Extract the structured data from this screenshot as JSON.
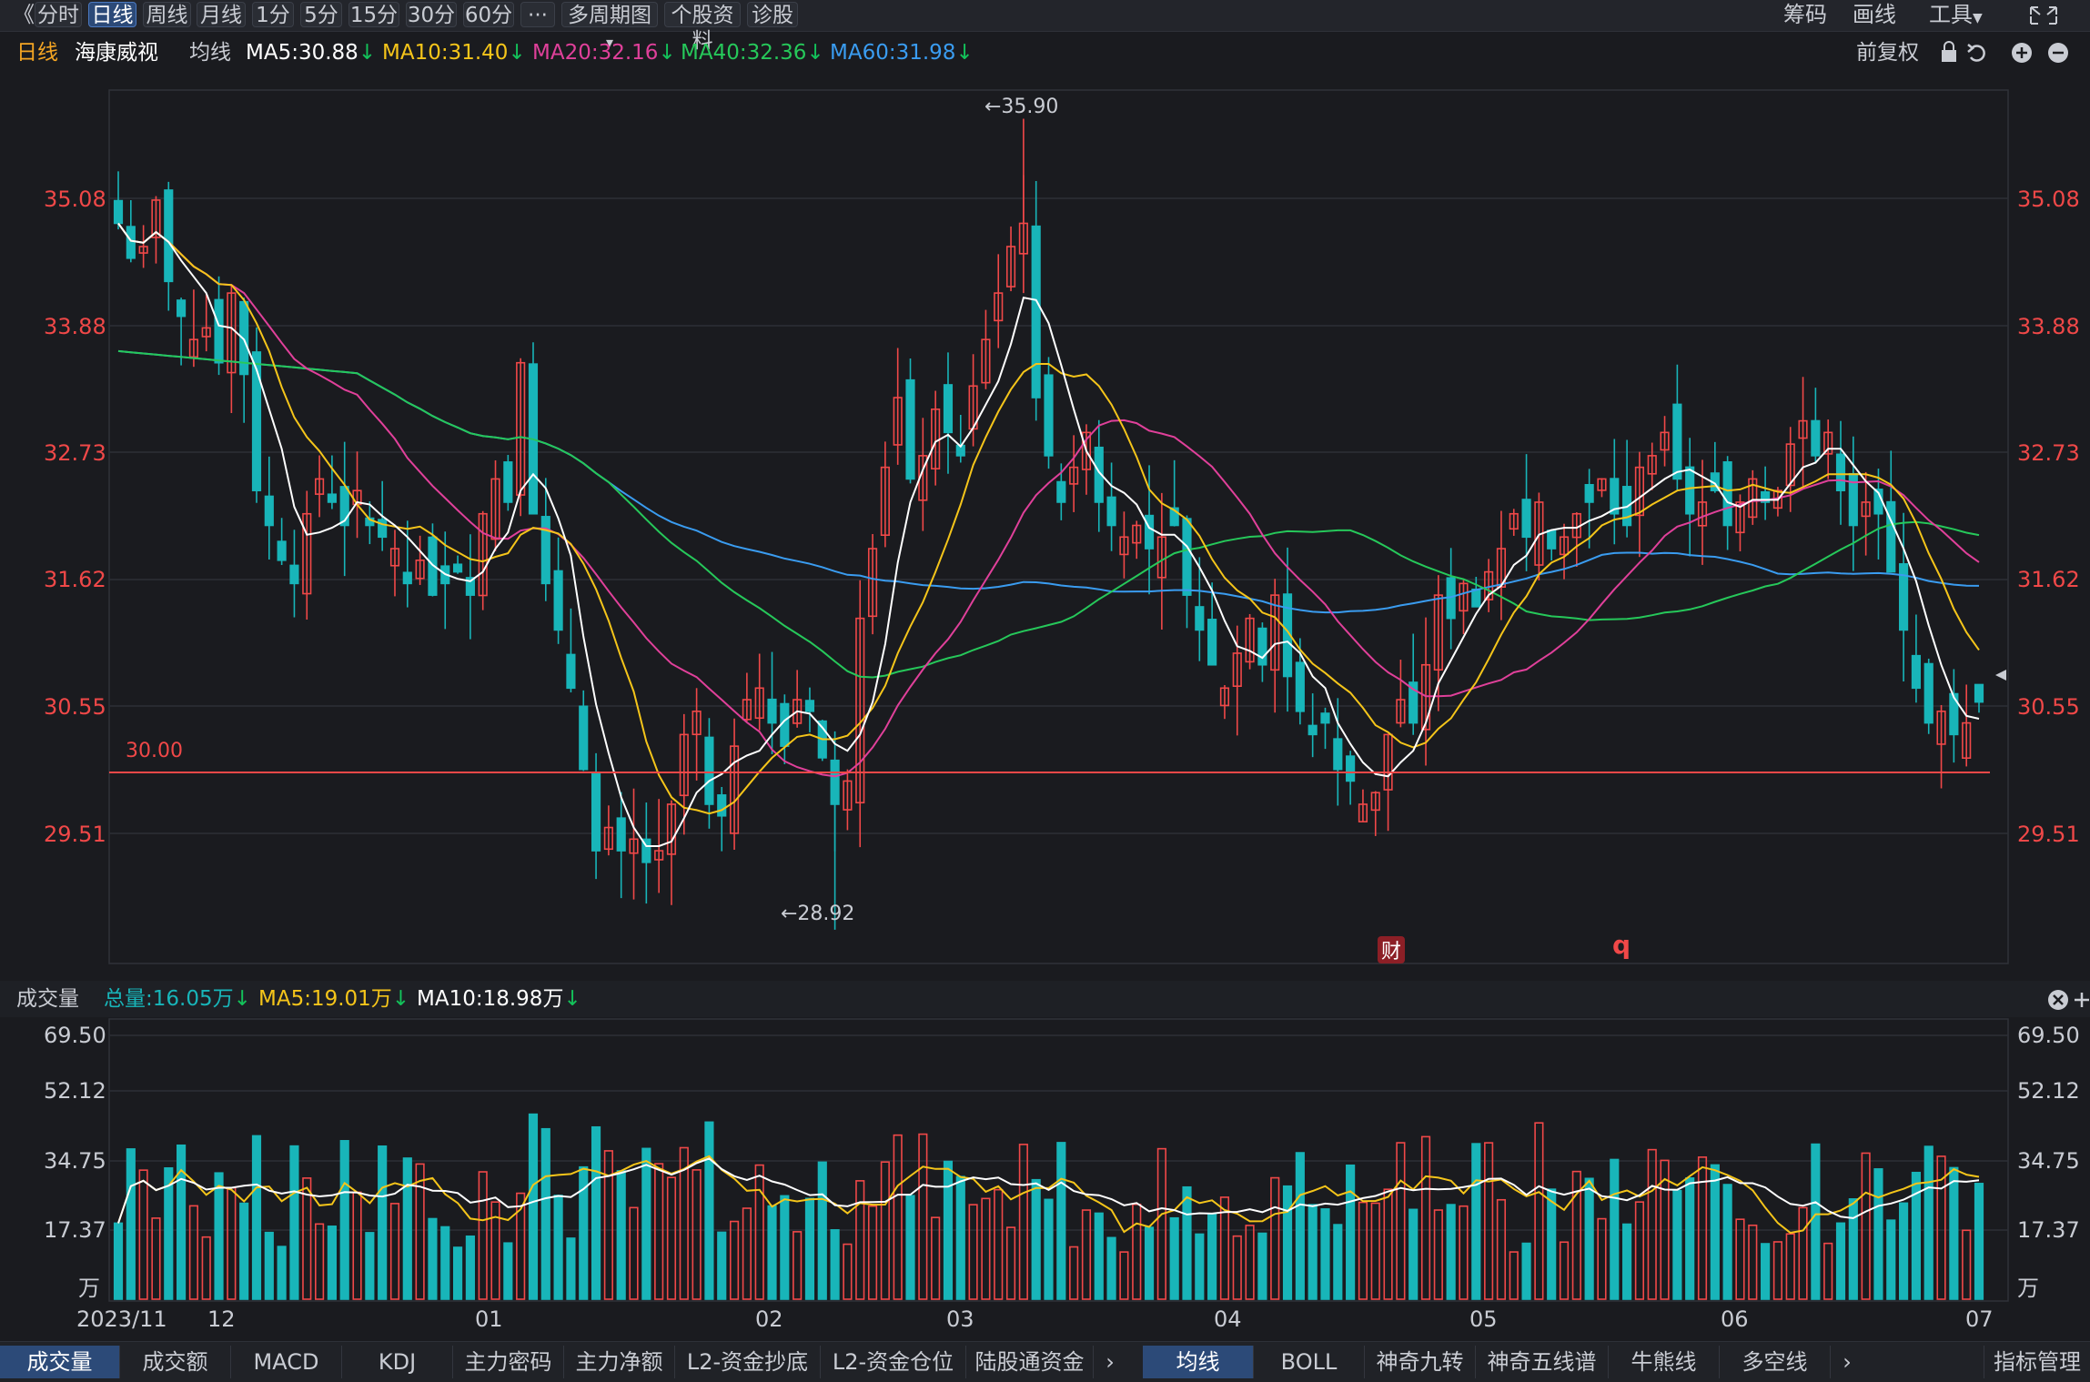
{
  "toolbar": {
    "collapse": "《",
    "periods": [
      "分时",
      "日线",
      "周线",
      "月线",
      "1分",
      "5分",
      "15分",
      "30分",
      "60分"
    ],
    "active_period": "日线",
    "more": "···",
    "multi_period": "多周期图",
    "stock_info": "个股资料",
    "diagnose": "诊股",
    "chips": "筹码",
    "draw": "画线",
    "tools": "工具"
  },
  "header": {
    "period": "日线",
    "stock_name": "海康威视",
    "ma_label": "均线",
    "ma5": "MA5:30.88",
    "ma10": "MA10:31.40",
    "ma20": "MA20:32.16",
    "ma40": "MA40:32.36",
    "ma60": "MA60:31.98",
    "adjust": "前复权"
  },
  "price_chart": {
    "y_ticks": [
      "35.08",
      "33.88",
      "32.73",
      "31.62",
      "30.55",
      "29.51"
    ],
    "high_label": "←35.90",
    "low_label": "←28.92",
    "ref_line_label": "30.00",
    "finance_badge": "财",
    "q_badge": "q"
  },
  "volume_header": {
    "title": "成交量",
    "total": "总量:16.05万",
    "ma5": "MA5:19.01万",
    "ma10": "MA10:18.98万"
  },
  "volume_chart": {
    "y_ticks": [
      "69.50",
      "52.12",
      "34.75",
      "17.37"
    ],
    "unit": "万"
  },
  "x_axis": [
    "2023/11",
    "12",
    "01",
    "02",
    "03",
    "04",
    "05",
    "06",
    "07"
  ],
  "bottom_left_tabs": [
    "成交量",
    "成交额",
    "MACD",
    "KDJ",
    "主力密码",
    "主力净额",
    "L2-资金抄底",
    "L2-资金仓位",
    "陆股通资金"
  ],
  "bottom_right_tabs": [
    "均线",
    "BOLL",
    "神奇九转",
    "神奇五线谱",
    "牛熊线",
    "多空线"
  ],
  "indicator_manage": "指标管理",
  "colors": {
    "up": "#f04848",
    "down": "#18b5b9",
    "ma5": "#ffffff",
    "ma10": "#f5c51a",
    "ma20": "#e0409a",
    "ma40": "#26c85a",
    "ma60": "#3a9cf0",
    "axis_red": "#f04848"
  },
  "chart_data": {
    "type": "candlestick",
    "title": "",
    "series_name": "海康威视",
    "y_range": [
      28.7,
      36.1
    ],
    "x_labels": [
      "2023/11",
      "12",
      "01",
      "02",
      "03",
      "04",
      "05",
      "06",
      "07"
    ],
    "high_marker": 35.9,
    "low_marker": 28.92,
    "reference_line": 30.0,
    "closes": [
      35.0,
      34.7,
      34.8,
      35.2,
      34.5,
      34.2,
      34.0,
      34.1,
      33.8,
      34.4,
      33.7,
      32.7,
      32.4,
      32.1,
      31.9,
      32.5,
      32.8,
      32.6,
      32.4,
      32.7,
      32.4,
      32.3,
      32.2,
      31.9,
      32.1,
      31.8,
      31.9,
      32.0,
      31.8,
      32.5,
      32.8,
      32.6,
      33.8,
      32.5,
      31.9,
      31.5,
      31.0,
      30.3,
      29.6,
      29.8,
      29.6,
      29.7,
      29.5,
      29.6,
      30.0,
      30.6,
      30.8,
      30.0,
      29.9,
      30.5,
      30.9,
      31.0,
      30.7,
      30.5,
      30.9,
      30.8,
      30.4,
      30.0,
      30.2,
      31.6,
      32.2,
      32.9,
      33.5,
      32.8,
      33.0,
      33.4,
      33.2,
      33.0,
      33.6,
      34.0,
      34.4,
      34.8,
      35.0,
      33.5,
      33.0,
      32.6,
      32.9,
      33.2,
      32.6,
      32.4,
      32.3,
      32.4,
      32.2,
      32.3,
      32.4,
      31.8,
      31.5,
      31.2,
      31.0,
      31.3,
      31.6,
      31.2,
      31.8,
      31.1,
      30.8,
      30.6,
      30.7,
      30.3,
      30.2,
      30.0,
      30.1,
      30.6,
      30.9,
      30.7,
      31.2,
      31.8,
      31.6,
      31.9,
      31.7,
      32.0,
      32.2,
      32.5,
      32.3,
      32.6,
      32.2,
      32.3,
      32.5,
      32.6,
      32.8,
      32.5,
      32.4,
      32.9,
      33.0,
      33.2,
      32.8,
      32.5,
      32.6,
      32.7,
      32.4,
      32.6,
      32.8,
      32.6,
      32.7,
      33.1,
      33.3,
      33.0,
      33.2,
      32.7,
      32.4,
      32.6,
      32.5,
      32.0,
      31.5,
      31.0,
      30.7,
      30.8,
      30.6,
      30.7,
      30.88
    ],
    "volume_y_range": [
      0,
      69.5
    ],
    "volume_unit": "万"
  }
}
